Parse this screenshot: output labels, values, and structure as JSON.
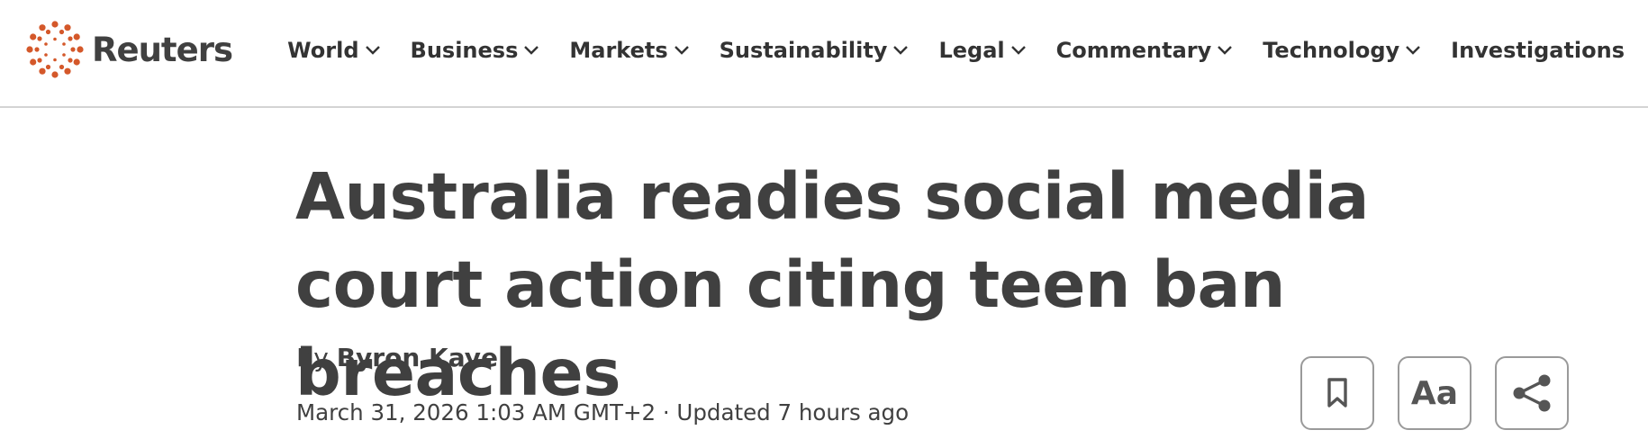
{
  "header": {
    "logo_text": "Reuters",
    "brand_color": "#d4582a",
    "nav": [
      {
        "label": "World",
        "has_dropdown": true
      },
      {
        "label": "Business",
        "has_dropdown": true
      },
      {
        "label": "Markets",
        "has_dropdown": true
      },
      {
        "label": "Sustainability",
        "has_dropdown": true
      },
      {
        "label": "Legal",
        "has_dropdown": true
      },
      {
        "label": "Commentary",
        "has_dropdown": true
      },
      {
        "label": "Technology",
        "has_dropdown": true
      },
      {
        "label": "Investigations",
        "has_dropdown": false
      }
    ]
  },
  "article": {
    "headline": "Australia readies social media court action citing teen ban breaches",
    "byline_prefix": "By",
    "author": "Byron Kaye",
    "dateline": "March 31, 2026 1:03 AM GMT+2 · Updated 7 hours ago"
  },
  "toolbar": {
    "bookmark_icon": "bookmark-icon",
    "text_size_label": "Aa",
    "share_icon": "share-icon"
  }
}
